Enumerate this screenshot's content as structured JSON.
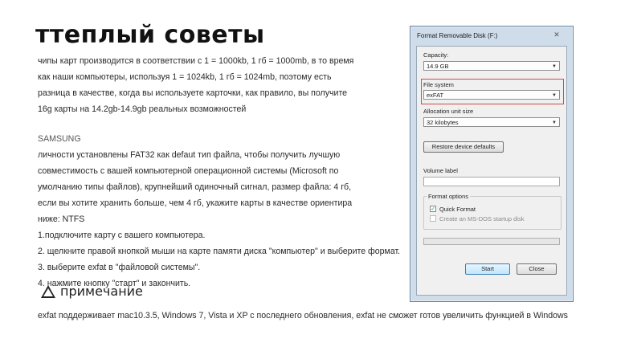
{
  "title": "ттеплый советы",
  "paragraph1": [
    "чипы карт производится в соответствии с 1 = 1000kb, 1 гб = 1000mb, в то время",
    "как наши компьютеры, используя 1 = 1024kb, 1 гб = 1024mb, поэтому есть",
    "разница в качестве, когда вы используете карточки, как правило, вы получите",
    "16g карты на 14.2gb-14.9gb реальных возможностей"
  ],
  "brand": "SAMSUNG",
  "paragraph2": [
    "личности установлены FAT32 как defaut тип файла, чтобы получить лучшую",
    "совместимость с вашей компьютерной операционной системы (Microsoft по",
    "умолчанию типы файлов), крупнейший одиночный сигнал, размер файла: 4 гб,",
    "если вы хотите хранить больше, чем 4 гб, укажите карты в качестве ориентира",
    "ниже: NTFS",
    "1.подключите карту с вашего компьютера.",
    "2. щелкните правой кнопкой мыши на карте памяти диска \"компьютер\" и выберите формат.",
    "3. выберите exfat в \"файловой системы\".",
    "4. нажмите кнопку \"старт\" и закончить."
  ],
  "note_label": "примечание",
  "footer": "exfat поддерживает mac10.3.5, Windows 7, Vista и XP с последнего обновления, exfat не сможет готов увеличить функцией в Windows",
  "dialog": {
    "title": "Format Removable Disk (F:)",
    "close_glyph": "✕",
    "capacity_label": "Capacity:",
    "capacity_value": "14.9 GB",
    "filesystem_label": "File system",
    "filesystem_value": "exFAT",
    "allocation_label": "Allocation unit size",
    "allocation_value": "32 kilobytes",
    "restore_button": "Restore device defaults",
    "volume_label": "Volume label",
    "volume_value": "",
    "format_options_label": "Format options",
    "quick_format_label": "Quick Format",
    "quick_format_checked": true,
    "msdos_label": "Create an MS-DOS startup disk",
    "msdos_checked": false,
    "progress": 0,
    "start_button": "Start",
    "close_button": "Close"
  },
  "colors": {
    "highlight_border": "#d24a4a",
    "dialog_frame": "#cfdcea"
  },
  "icons": {
    "note": "warning-triangle-icon",
    "dropdown": "chevron-down-icon",
    "check": "checkmark-icon"
  }
}
